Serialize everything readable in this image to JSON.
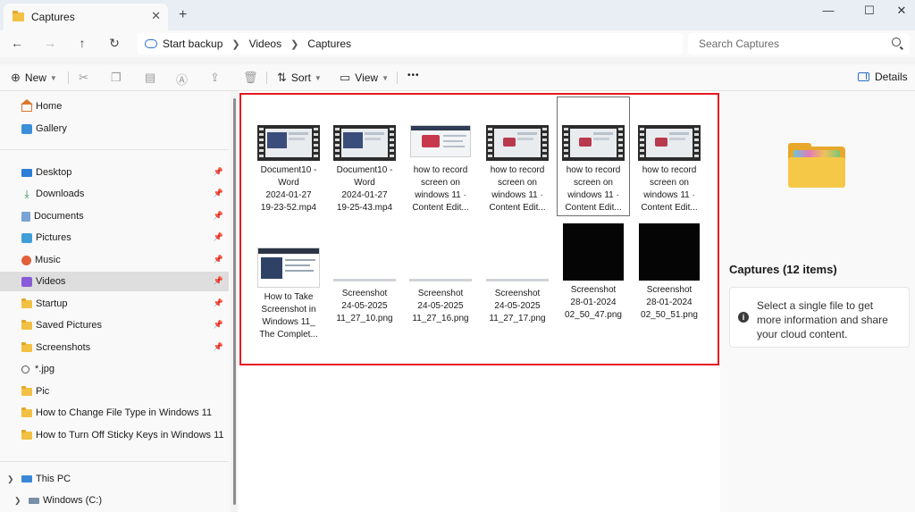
{
  "window": {
    "tab_title": "Captures",
    "tab_close": "✕",
    "new_tab": "+",
    "minimize": "—",
    "maximize": "☐",
    "close": "✕"
  },
  "address": {
    "back": "←",
    "forward": "→",
    "up": "↑",
    "refresh": "↻",
    "crumbs": [
      "Start backup",
      "Videos",
      "Captures"
    ],
    "search_placeholder": "Search Captures"
  },
  "commands": {
    "new_label": "New",
    "sort_label": "Sort",
    "view_label": "View",
    "more": "•••",
    "details_label": "Details"
  },
  "sidebar": {
    "quick": [
      "Home",
      "Gallery"
    ],
    "pinned": [
      {
        "label": "Desktop",
        "icon": "desktop-icon"
      },
      {
        "label": "Downloads",
        "icon": "downloads-icon"
      },
      {
        "label": "Documents",
        "icon": "documents-icon"
      },
      {
        "label": "Pictures",
        "icon": "pictures-icon"
      },
      {
        "label": "Music",
        "icon": "music-icon"
      },
      {
        "label": "Videos",
        "icon": "videos-icon"
      },
      {
        "label": "Startup",
        "icon": "folder-icon"
      },
      {
        "label": "Saved Pictures",
        "icon": "folder-icon"
      },
      {
        "label": "Screenshots",
        "icon": "folder-icon"
      }
    ],
    "others": [
      {
        "label": "*.jpg",
        "icon": "search-icon"
      },
      {
        "label": "Pic",
        "icon": "folder-icon"
      },
      {
        "label": "How to Change File Type in Windows 11",
        "icon": "folder-icon"
      },
      {
        "label": "How to Turn Off Sticky Keys in Windows 11",
        "icon": "folder-icon"
      }
    ],
    "this_pc": "This PC",
    "drive": "Windows (C:)",
    "selected": "Videos"
  },
  "files": [
    {
      "lines": [
        "Document10 -",
        "Word",
        "2024-01-27",
        "19-23-52.mp4"
      ],
      "thumb": "video"
    },
    {
      "lines": [
        "Document10 -",
        "Word",
        "2024-01-27",
        "19-25-43.mp4"
      ],
      "thumb": "video"
    },
    {
      "lines": [
        "how to record",
        "screen on",
        "windows 11 ·",
        "Content Edit..."
      ],
      "thumb": "doc"
    },
    {
      "lines": [
        "how to record",
        "screen on",
        "windows 11 ·",
        "Content Edit..."
      ],
      "thumb": "video-red"
    },
    {
      "lines": [
        "how to record",
        "screen on",
        "windows 11 ·",
        "Content Edit..."
      ],
      "thumb": "video-red"
    },
    {
      "lines": [
        "how to record",
        "screen on",
        "windows 11 ·",
        "Content Edit..."
      ],
      "thumb": "video-red"
    },
    {
      "lines": [
        "How to Take",
        "Screenshot in",
        "Windows 11_",
        "The Complet..."
      ],
      "thumb": "page"
    },
    {
      "lines": [
        "Screenshot",
        "24-05-2025",
        "11_27_10.png"
      ],
      "thumb": "strip"
    },
    {
      "lines": [
        "Screenshot",
        "24-05-2025",
        "11_27_16.png"
      ],
      "thumb": "strip"
    },
    {
      "lines": [
        "Screenshot",
        "24-05-2025",
        "11_27_17.png"
      ],
      "thumb": "strip"
    },
    {
      "lines": [
        "Screenshot",
        "28-01-2024",
        "02_50_47.png"
      ],
      "thumb": "black"
    },
    {
      "lines": [
        "Screenshot",
        "28-01-2024",
        "02_50_51.png"
      ],
      "thumb": "black"
    }
  ],
  "details_pane": {
    "title": "Captures (12 items)",
    "info": "Select a single file to get more information and share your cloud content.",
    "info_icon": "i"
  },
  "colors": {
    "highlight_border": "#e4181f",
    "accent": "#2b6fc9"
  }
}
